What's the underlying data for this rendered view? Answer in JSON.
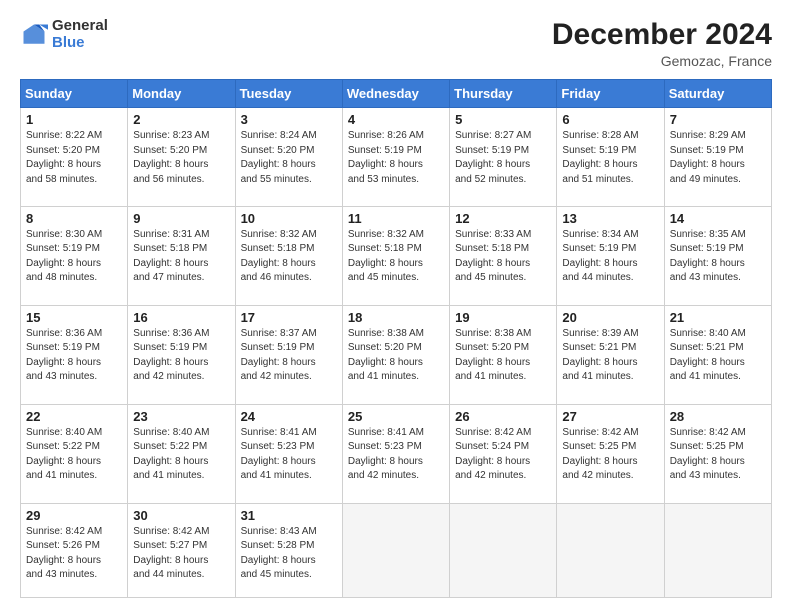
{
  "header": {
    "logo_general": "General",
    "logo_blue": "Blue",
    "month_title": "December 2024",
    "location": "Gemozac, France"
  },
  "days_of_week": [
    "Sunday",
    "Monday",
    "Tuesday",
    "Wednesday",
    "Thursday",
    "Friday",
    "Saturday"
  ],
  "weeks": [
    [
      {
        "day": "1",
        "lines": [
          "Sunrise: 8:22 AM",
          "Sunset: 5:20 PM",
          "Daylight: 8 hours",
          "and 58 minutes."
        ]
      },
      {
        "day": "2",
        "lines": [
          "Sunrise: 8:23 AM",
          "Sunset: 5:20 PM",
          "Daylight: 8 hours",
          "and 56 minutes."
        ]
      },
      {
        "day": "3",
        "lines": [
          "Sunrise: 8:24 AM",
          "Sunset: 5:20 PM",
          "Daylight: 8 hours",
          "and 55 minutes."
        ]
      },
      {
        "day": "4",
        "lines": [
          "Sunrise: 8:26 AM",
          "Sunset: 5:19 PM",
          "Daylight: 8 hours",
          "and 53 minutes."
        ]
      },
      {
        "day": "5",
        "lines": [
          "Sunrise: 8:27 AM",
          "Sunset: 5:19 PM",
          "Daylight: 8 hours",
          "and 52 minutes."
        ]
      },
      {
        "day": "6",
        "lines": [
          "Sunrise: 8:28 AM",
          "Sunset: 5:19 PM",
          "Daylight: 8 hours",
          "and 51 minutes."
        ]
      },
      {
        "day": "7",
        "lines": [
          "Sunrise: 8:29 AM",
          "Sunset: 5:19 PM",
          "Daylight: 8 hours",
          "and 49 minutes."
        ]
      }
    ],
    [
      {
        "day": "8",
        "lines": [
          "Sunrise: 8:30 AM",
          "Sunset: 5:19 PM",
          "Daylight: 8 hours",
          "and 48 minutes."
        ]
      },
      {
        "day": "9",
        "lines": [
          "Sunrise: 8:31 AM",
          "Sunset: 5:18 PM",
          "Daylight: 8 hours",
          "and 47 minutes."
        ]
      },
      {
        "day": "10",
        "lines": [
          "Sunrise: 8:32 AM",
          "Sunset: 5:18 PM",
          "Daylight: 8 hours",
          "and 46 minutes."
        ]
      },
      {
        "day": "11",
        "lines": [
          "Sunrise: 8:32 AM",
          "Sunset: 5:18 PM",
          "Daylight: 8 hours",
          "and 45 minutes."
        ]
      },
      {
        "day": "12",
        "lines": [
          "Sunrise: 8:33 AM",
          "Sunset: 5:18 PM",
          "Daylight: 8 hours",
          "and 45 minutes."
        ]
      },
      {
        "day": "13",
        "lines": [
          "Sunrise: 8:34 AM",
          "Sunset: 5:19 PM",
          "Daylight: 8 hours",
          "and 44 minutes."
        ]
      },
      {
        "day": "14",
        "lines": [
          "Sunrise: 8:35 AM",
          "Sunset: 5:19 PM",
          "Daylight: 8 hours",
          "and 43 minutes."
        ]
      }
    ],
    [
      {
        "day": "15",
        "lines": [
          "Sunrise: 8:36 AM",
          "Sunset: 5:19 PM",
          "Daylight: 8 hours",
          "and 43 minutes."
        ]
      },
      {
        "day": "16",
        "lines": [
          "Sunrise: 8:36 AM",
          "Sunset: 5:19 PM",
          "Daylight: 8 hours",
          "and 42 minutes."
        ]
      },
      {
        "day": "17",
        "lines": [
          "Sunrise: 8:37 AM",
          "Sunset: 5:19 PM",
          "Daylight: 8 hours",
          "and 42 minutes."
        ]
      },
      {
        "day": "18",
        "lines": [
          "Sunrise: 8:38 AM",
          "Sunset: 5:20 PM",
          "Daylight: 8 hours",
          "and 41 minutes."
        ]
      },
      {
        "day": "19",
        "lines": [
          "Sunrise: 8:38 AM",
          "Sunset: 5:20 PM",
          "Daylight: 8 hours",
          "and 41 minutes."
        ]
      },
      {
        "day": "20",
        "lines": [
          "Sunrise: 8:39 AM",
          "Sunset: 5:21 PM",
          "Daylight: 8 hours",
          "and 41 minutes."
        ]
      },
      {
        "day": "21",
        "lines": [
          "Sunrise: 8:40 AM",
          "Sunset: 5:21 PM",
          "Daylight: 8 hours",
          "and 41 minutes."
        ]
      }
    ],
    [
      {
        "day": "22",
        "lines": [
          "Sunrise: 8:40 AM",
          "Sunset: 5:22 PM",
          "Daylight: 8 hours",
          "and 41 minutes."
        ]
      },
      {
        "day": "23",
        "lines": [
          "Sunrise: 8:40 AM",
          "Sunset: 5:22 PM",
          "Daylight: 8 hours",
          "and 41 minutes."
        ]
      },
      {
        "day": "24",
        "lines": [
          "Sunrise: 8:41 AM",
          "Sunset: 5:23 PM",
          "Daylight: 8 hours",
          "and 41 minutes."
        ]
      },
      {
        "day": "25",
        "lines": [
          "Sunrise: 8:41 AM",
          "Sunset: 5:23 PM",
          "Daylight: 8 hours",
          "and 42 minutes."
        ]
      },
      {
        "day": "26",
        "lines": [
          "Sunrise: 8:42 AM",
          "Sunset: 5:24 PM",
          "Daylight: 8 hours",
          "and 42 minutes."
        ]
      },
      {
        "day": "27",
        "lines": [
          "Sunrise: 8:42 AM",
          "Sunset: 5:25 PM",
          "Daylight: 8 hours",
          "and 42 minutes."
        ]
      },
      {
        "day": "28",
        "lines": [
          "Sunrise: 8:42 AM",
          "Sunset: 5:25 PM",
          "Daylight: 8 hours",
          "and 43 minutes."
        ]
      }
    ],
    [
      {
        "day": "29",
        "lines": [
          "Sunrise: 8:42 AM",
          "Sunset: 5:26 PM",
          "Daylight: 8 hours",
          "and 43 minutes."
        ]
      },
      {
        "day": "30",
        "lines": [
          "Sunrise: 8:42 AM",
          "Sunset: 5:27 PM",
          "Daylight: 8 hours",
          "and 44 minutes."
        ]
      },
      {
        "day": "31",
        "lines": [
          "Sunrise: 8:43 AM",
          "Sunset: 5:28 PM",
          "Daylight: 8 hours",
          "and 45 minutes."
        ]
      },
      {
        "day": "",
        "lines": []
      },
      {
        "day": "",
        "lines": []
      },
      {
        "day": "",
        "lines": []
      },
      {
        "day": "",
        "lines": []
      }
    ]
  ]
}
